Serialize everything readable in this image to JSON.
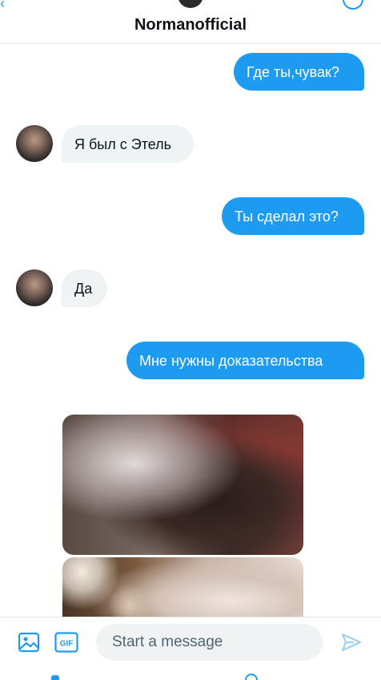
{
  "header": {
    "title": "Normanofficial"
  },
  "messages": [
    {
      "direction": "out",
      "text": "Где ты,чувак?"
    },
    {
      "direction": "in",
      "text": "Я был с Этель"
    },
    {
      "direction": "out",
      "text": "Ты сделал это?"
    },
    {
      "direction": "in",
      "text": "Да"
    },
    {
      "direction": "out",
      "text": "Мне нужны доказательства"
    }
  ],
  "media": [
    {
      "kind": "photo",
      "description_hidden": true
    },
    {
      "kind": "photo",
      "description_hidden": true
    }
  ],
  "composer": {
    "placeholder": "Start a message",
    "gif_label": "GIF",
    "icons": [
      "image-icon",
      "gif-icon",
      "send-icon"
    ]
  },
  "colors": {
    "accent": "#1d9bf0",
    "incoming_bubble": "#eff3f4",
    "text": "#0f1419",
    "placeholder": "#536471"
  }
}
